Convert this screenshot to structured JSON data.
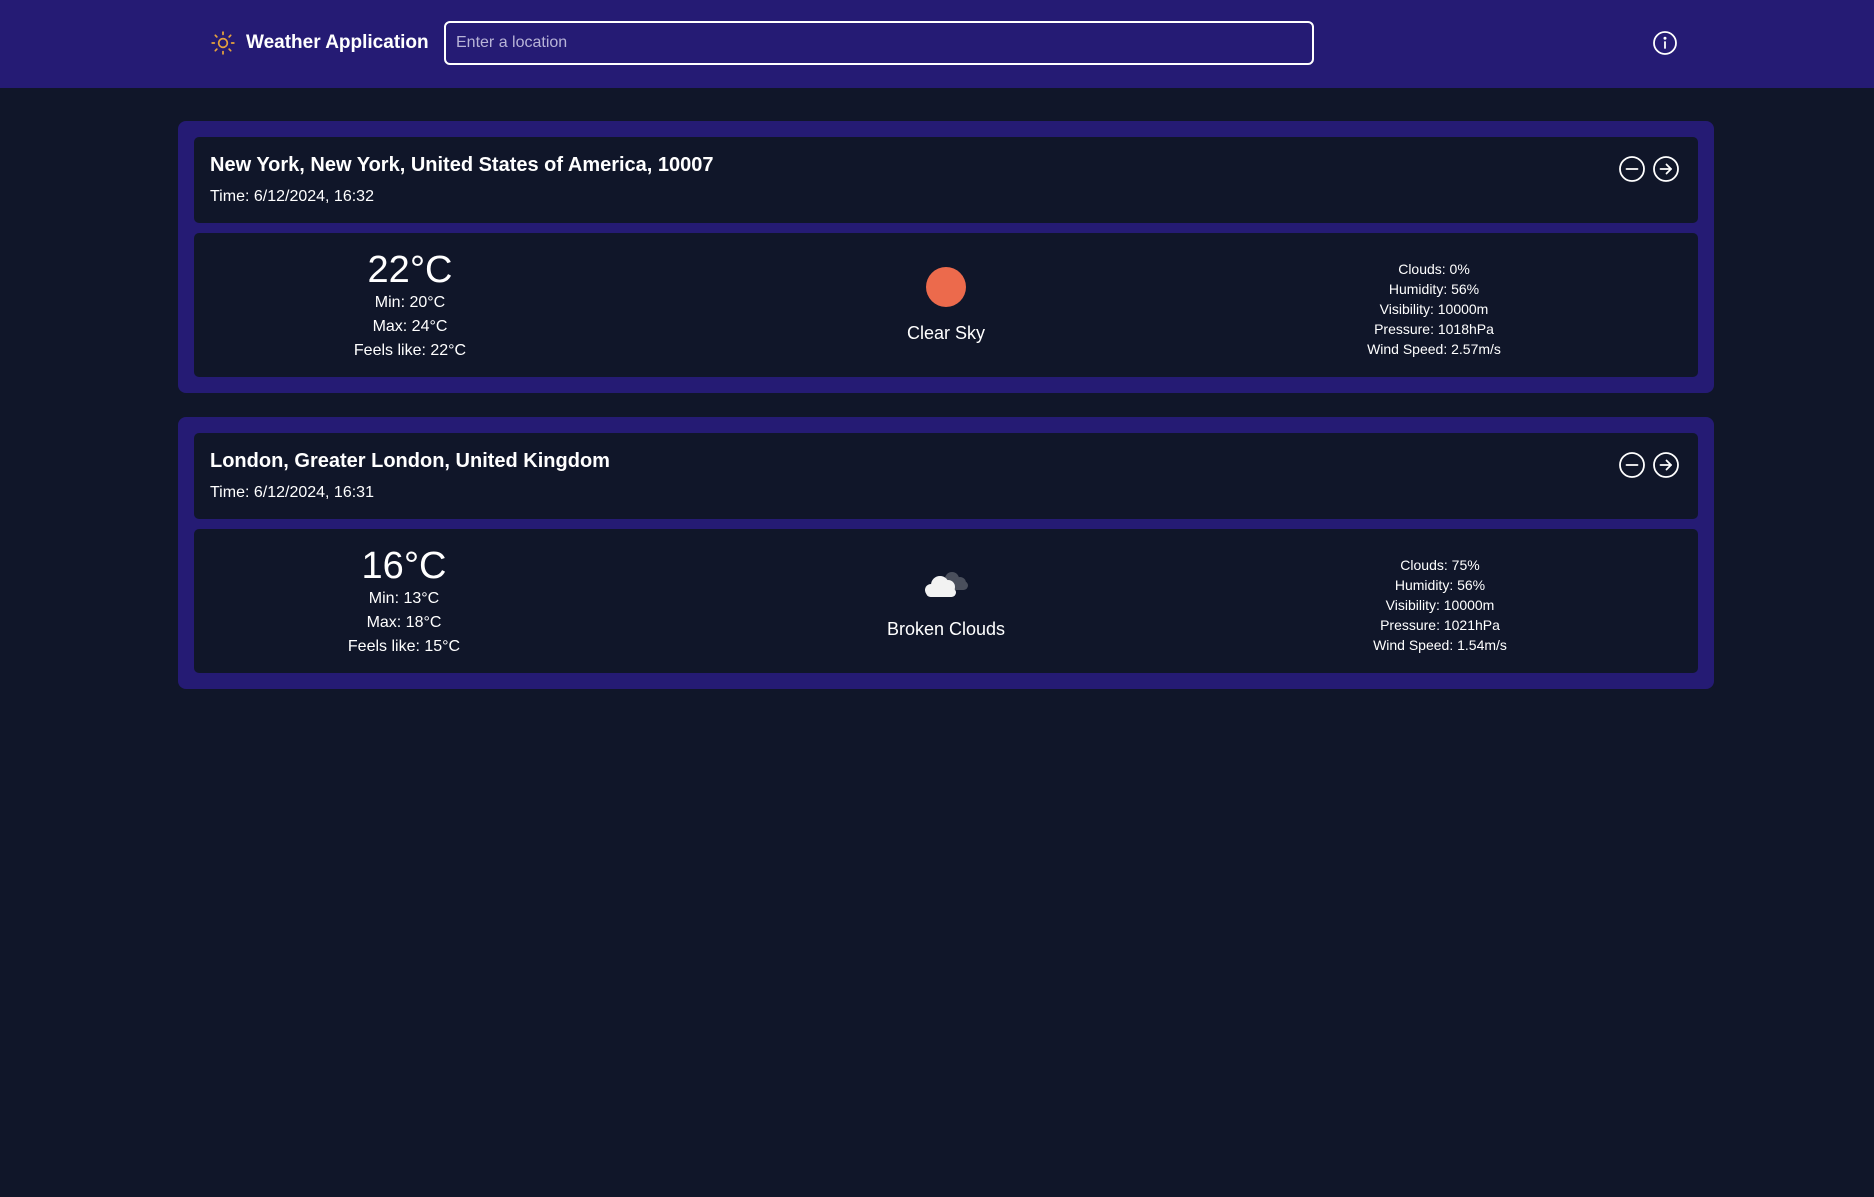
{
  "app": {
    "title": "Weather Application",
    "icon": "sun-icon",
    "accent_color": "#e7a33c"
  },
  "search": {
    "placeholder": "Enter a location",
    "value": ""
  },
  "header": {
    "info_icon": "info-icon",
    "background_color": "#251b74"
  },
  "time_prefix": "Time: ",
  "locations": [
    {
      "name": "New York, New York, United States of America, 10007",
      "time": "6/12/2024, 16:32",
      "temp": "22°C",
      "min": "Min: 20°C",
      "max": "Max: 24°C",
      "feels_like": "Feels like: 22°C",
      "condition": "Clear Sky",
      "condition_icon": "sun-icon",
      "stats": {
        "clouds": "Clouds: 0%",
        "humidity": "Humidity: 56%",
        "visibility": "Visibility: 10000m",
        "pressure": "Pressure: 1018hPa",
        "wind": "Wind Speed: 2.57m/s"
      }
    },
    {
      "name": "London, Greater London, United Kingdom",
      "time": "6/12/2024, 16:31",
      "temp": "16°C",
      "min": "Min: 13°C",
      "max": "Max: 18°C",
      "feels_like": "Feels like: 15°C",
      "condition": "Broken Clouds",
      "condition_icon": "broken-clouds-icon",
      "stats": {
        "clouds": "Clouds: 75%",
        "humidity": "Humidity: 56%",
        "visibility": "Visibility: 10000m",
        "pressure": "Pressure: 1021hPa",
        "wind": "Wind Speed: 1.54m/s"
      }
    }
  ],
  "colors": {
    "page_background": "#101629",
    "card_frame": "#251b74",
    "sun": "#ec6a4c",
    "text": "#ffffff"
  }
}
